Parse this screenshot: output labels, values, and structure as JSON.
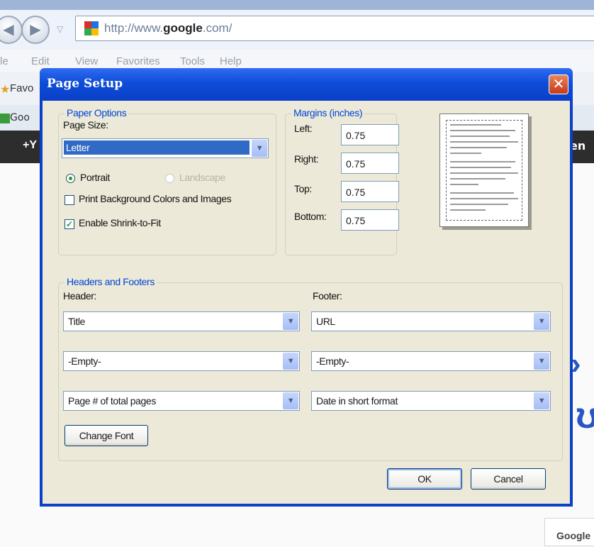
{
  "browser": {
    "back_glyph": "◀",
    "forward_glyph": "▶",
    "dropdown_glyph": "▽",
    "address": {
      "prefix": "http://www.",
      "domain": "google",
      "suffix": ".com/"
    },
    "menu": [
      "le",
      "Edit",
      "View",
      "Favorites",
      "Tools",
      "Help"
    ],
    "favorites_fragment": "Favo",
    "tab_fragment": "Goo",
    "google_bar_left": "+Y",
    "google_bar_right": "en",
    "footer_fragment": "Google"
  },
  "dialog": {
    "title": "Page Setup",
    "close_glyph": "✕",
    "paper_options": {
      "legend": "Paper Options",
      "page_size_label": "Page Size:",
      "page_size_value": "Letter",
      "portrait_label": "Portrait",
      "landscape_label": "Landscape",
      "orientation": "Portrait",
      "print_background_label": "Print Background Colors and Images",
      "print_background_checked": false,
      "shrink_to_fit_label": "Enable Shrink-to-Fit",
      "shrink_to_fit_checked": true
    },
    "margins": {
      "legend": "Margins (inches)",
      "left_label": "Left:",
      "left_value": "0.75",
      "right_label": "Right:",
      "right_value": "0.75",
      "top_label": "Top:",
      "top_value": "0.75",
      "bottom_label": "Bottom:",
      "bottom_value": "0.75"
    },
    "headers_footers": {
      "legend": "Headers and Footers",
      "header_label": "Header:",
      "footer_label": "Footer:",
      "header_values": [
        "Title",
        "-Empty-",
        "Page # of total pages"
      ],
      "footer_values": [
        "URL",
        "-Empty-",
        "Date in short format"
      ],
      "change_font_label": "Change Font"
    },
    "ok_label": "OK",
    "cancel_label": "Cancel",
    "dropdown_glyph": "▼",
    "check_glyph": "✓"
  },
  "colors": {
    "titlebar_blue": "#0a3fc8",
    "legend_blue": "#0046d5",
    "dialog_face": "#ece9d8",
    "selection_blue": "#316ac5",
    "close_red": "#c6391a"
  }
}
